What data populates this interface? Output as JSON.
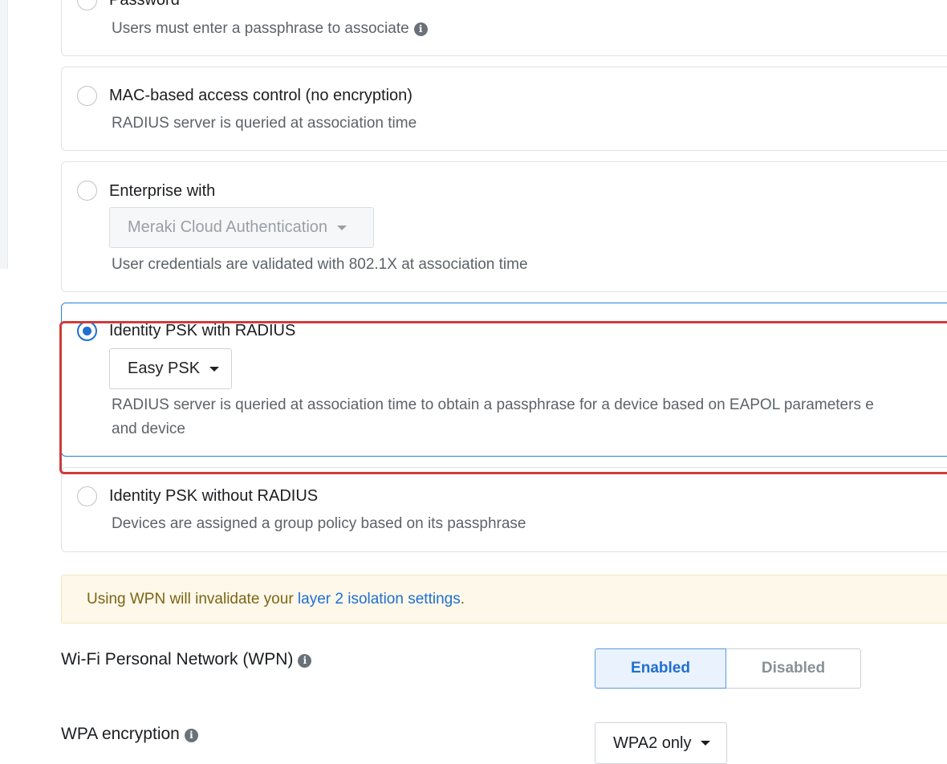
{
  "auth_options": [
    {
      "title": "Password",
      "description": "Users must enter a passphrase to associate",
      "selected": false
    },
    {
      "title": "MAC-based access control (no encryption)",
      "description": "RADIUS server is queried at association time",
      "selected": false
    },
    {
      "title": "Enterprise with",
      "dropdown_value": "Meraki Cloud Authentication",
      "description": "User credentials are validated with 802.1X at association time",
      "selected": false
    },
    {
      "title": "Identity PSK with RADIUS",
      "dropdown_value": "Easy PSK",
      "description_line1": "RADIUS server is queried at association time to obtain a passphrase for a device based on EAPOL parameters e",
      "description_line2": "and device",
      "selected": true
    },
    {
      "title": "Identity PSK without RADIUS",
      "description": "Devices are assigned a group policy based on its passphrase",
      "selected": false
    }
  ],
  "warning": {
    "prefix": "Using WPN will invalidate your ",
    "link": "layer 2 isolation settings",
    "suffix": "."
  },
  "wpn": {
    "label": "Wi-Fi Personal Network (WPN)",
    "enabled_label": "Enabled",
    "disabled_label": "Disabled",
    "value": "Enabled"
  },
  "wpa": {
    "label": "WPA encryption",
    "value": "WPA2 only"
  },
  "icons": {
    "info": "info-icon",
    "caret": "caret-down-icon"
  },
  "colors": {
    "accent": "#1f6fd1",
    "highlight": "#cf3c3c",
    "warning_bg": "#fdf8e9"
  }
}
